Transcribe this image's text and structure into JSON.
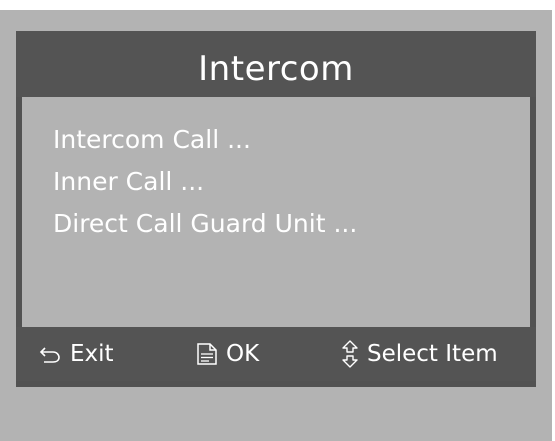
{
  "dialog": {
    "title": "Intercom"
  },
  "menu": {
    "items": [
      {
        "label": "Intercom Call  ..."
      },
      {
        "label": "Inner Call  ..."
      },
      {
        "label": "Direct Call Guard Unit  ..."
      }
    ]
  },
  "footer": {
    "exit_label": "Exit",
    "exit_icon": "back-arrow-icon",
    "ok_label": "OK",
    "ok_icon": "document-icon",
    "select_label": "Select Item",
    "select_icon": "up-down-arrows-icon"
  },
  "colors": {
    "frame": "#b3b3b3",
    "bar": "#545454",
    "text": "#ffffff"
  }
}
